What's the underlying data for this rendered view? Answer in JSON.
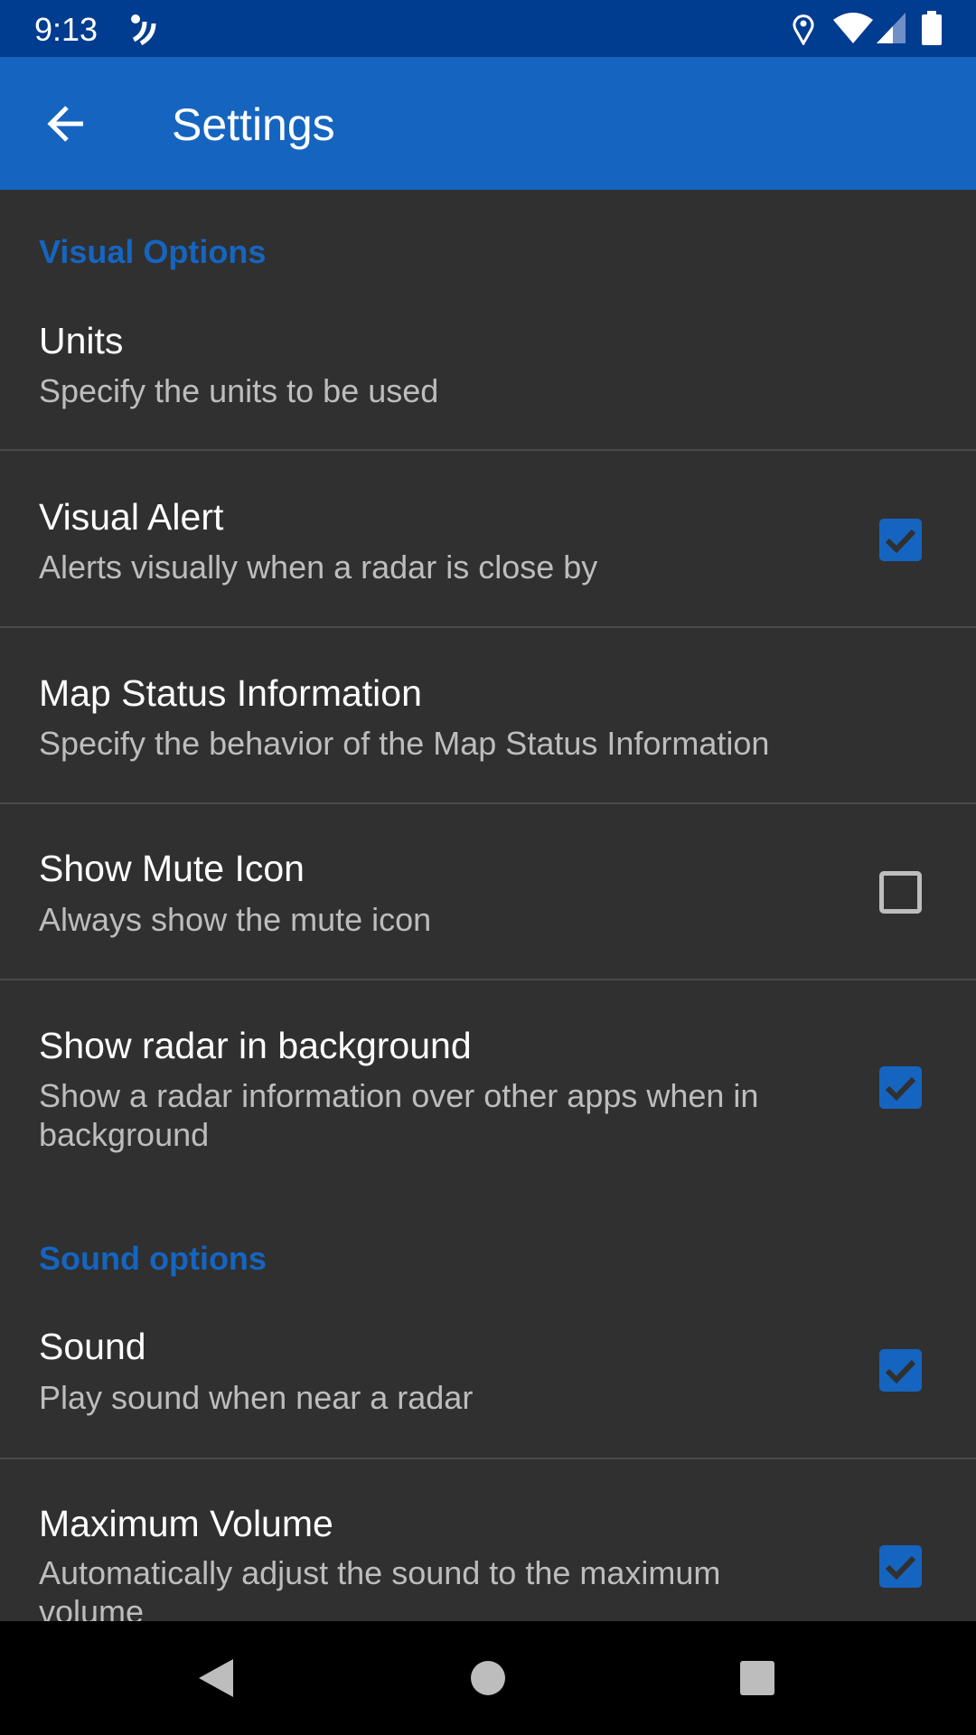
{
  "status_bar": {
    "time": "9:13",
    "icons": [
      "notification-icon",
      "location-icon",
      "wifi-icon",
      "signal-icon",
      "battery-icon"
    ]
  },
  "toolbar": {
    "title": "Settings",
    "back_icon": "arrow-back-icon"
  },
  "colors": {
    "accent": "#1565c0",
    "status_bar": "#003c8f",
    "background": "#303030"
  },
  "categories": {
    "visual": "Visual Options",
    "sound": "Sound options"
  },
  "prefs": [
    {
      "title": "Units",
      "summary": "Specify the units to be used"
    },
    {
      "title": "Visual Alert",
      "summary": "Alerts visually when a radar is close by",
      "checked": true
    },
    {
      "title": "Map Status Information",
      "summary": "Specify the behavior of the Map Status Information"
    },
    {
      "title": "Show Mute Icon",
      "summary": "Always show the mute icon",
      "checked": false
    },
    {
      "title": "Show radar in background",
      "summary": "Show a radar information over other apps when in background",
      "checked": true
    },
    {
      "title": "Sound",
      "summary": "Play sound when near a radar",
      "checked": true
    },
    {
      "title": "Maximum Volume",
      "summary": "Automatically adjust the sound to the maximum volume",
      "checked": true
    }
  ],
  "nav_bar": {
    "icons": [
      "back-triangle-icon",
      "home-circle-icon",
      "recents-square-icon"
    ]
  }
}
